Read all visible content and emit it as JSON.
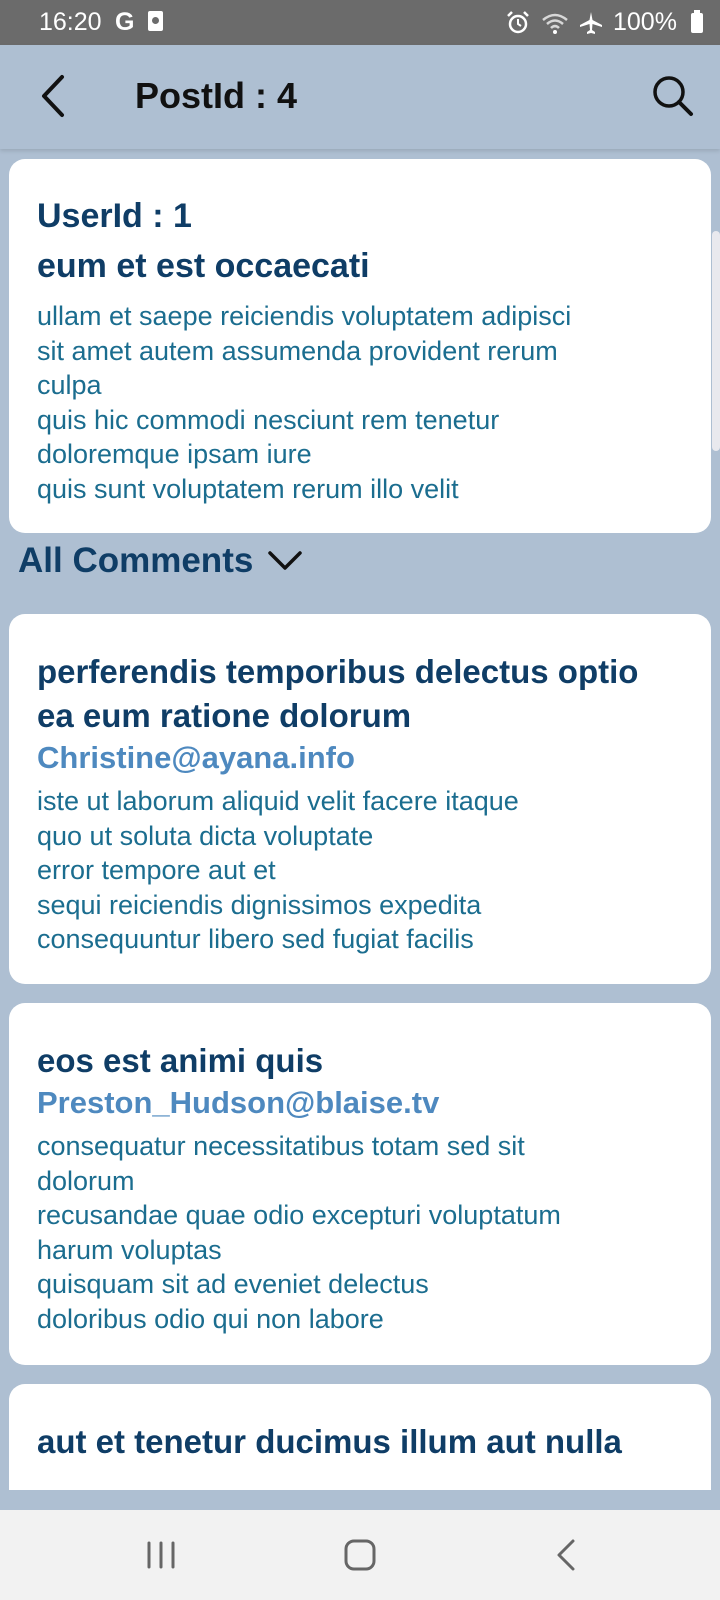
{
  "status_bar": {
    "time": "16:20",
    "g_label": "G",
    "battery_percent": "100%"
  },
  "app_bar": {
    "title": "PostId : 4",
    "back_icon": "chevron-left-icon",
    "search_icon": "search-icon"
  },
  "post": {
    "user_id_label": "UserId : 1",
    "title": "eum et est occaecati",
    "body": "ullam et saepe reiciendis voluptatem adipisci\nsit amet autem assumenda provident rerum\nculpa\nquis hic commodi nesciunt rem tenetur\ndoloremque ipsam iure\nquis sunt voluptatem rerum illo velit"
  },
  "comments_section": {
    "label": "All Comments",
    "toggle_icon": "chevron-down-icon"
  },
  "comments": [
    {
      "title": "perferendis temporibus delectus optio ea eum ratione dolorum",
      "email": "Christine@ayana.info",
      "body": "iste ut laborum aliquid velit facere itaque\nquo ut soluta dicta voluptate\nerror tempore aut et\nsequi reiciendis dignissimos expedita\nconsequuntur libero sed fugiat facilis"
    },
    {
      "title": "eos est animi quis",
      "email": "Preston_Hudson@blaise.tv",
      "body": "consequatur necessitatibus totam sed sit\ndolorum\nrecusandae quae odio excepturi voluptatum\nharum voluptas\nquisquam sit ad eveniet delectus\ndoloribus odio qui non labore"
    },
    {
      "title": "aut et tenetur ducimus illum aut nulla"
    }
  ],
  "colors": {
    "background": "#aebfd2",
    "card": "#ffffff",
    "heading": "#0f3d66",
    "body_text": "#1b6d8f",
    "email": "#4e89bf"
  },
  "nav_bar": {
    "recents_icon": "recents-icon",
    "home_icon": "home-icon",
    "back_icon": "back-icon"
  }
}
